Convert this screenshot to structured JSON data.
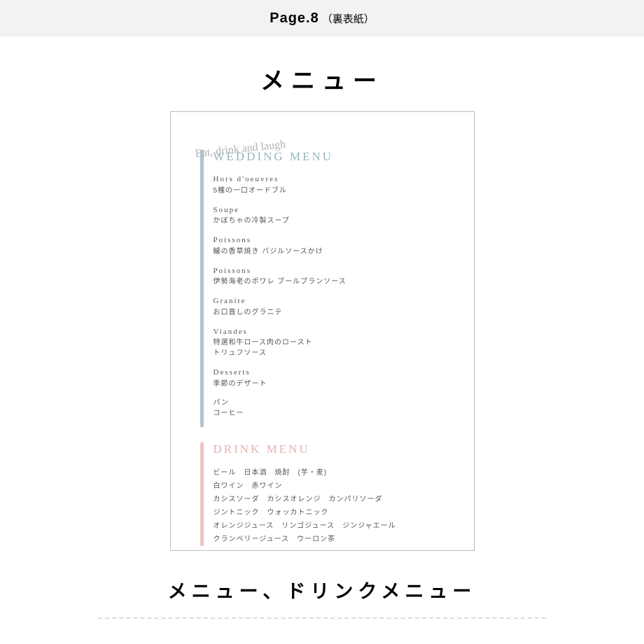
{
  "header": {
    "main": "Page.8",
    "sub": "（裏表紙）"
  },
  "title": "メニュー",
  "card": {
    "script": "Eat, drink and laugh",
    "wedding": {
      "title": "WEDDING MENU",
      "items": [
        {
          "en": "Hors d'oeuvres",
          "jp": "5種の一口オードブル"
        },
        {
          "en": "Soupe",
          "jp": "かぼちゃの冷製スープ"
        },
        {
          "en": "Poissons",
          "jp": "鱸の香草焼き バジルソースかけ"
        },
        {
          "en": "Poissons",
          "jp": "伊勢海老のポワレ ブールブランソース"
        },
        {
          "en": "Granite",
          "jp": "お口直しのグラニテ"
        },
        {
          "en": "Viandes",
          "jp": "特選和牛ロース肉のロースト",
          "jp2": "トリュフソース"
        },
        {
          "en": "Desserts",
          "jp": "季節のデザート"
        },
        {
          "en": "",
          "jp": "パン",
          "jp2": "コーヒー"
        }
      ]
    },
    "drink": {
      "title": "DRINK MENU",
      "lines": [
        "ビール　日本酒　焼酎　(芋・麦)",
        "白ワイン　赤ワイン",
        "カシスソーダ　カシスオレンジ　カンパリソーダ",
        "ジントニック　ウォッカトニック",
        "オレンジジュース　リンゴジュース　ジンジャエール",
        "クランベリージュース　ウーロン茶"
      ]
    }
  },
  "footer": "メニュー、ドリンクメニュー"
}
